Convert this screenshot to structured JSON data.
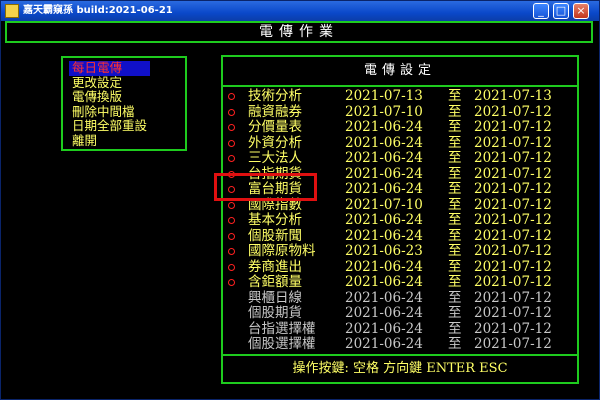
{
  "window": {
    "title": "嘉天霸窺孫 build:2021-06-21",
    "minimize_glyph": "_",
    "maximize_glyph": "□",
    "close_glyph": "×"
  },
  "header": {
    "title": "電傳作業"
  },
  "menu": {
    "items": [
      {
        "label": "每日電傳",
        "active": true
      },
      {
        "label": "更改設定",
        "active": false
      },
      {
        "label": "電傳換版",
        "active": false
      },
      {
        "label": "刪除中間檔",
        "active": false
      },
      {
        "label": "日期全部重設",
        "active": false
      },
      {
        "label": "離開",
        "active": false
      }
    ]
  },
  "settings": {
    "title": "電傳設定",
    "separator": "至",
    "rows": [
      {
        "name": "技術分析",
        "start": "2021-07-13",
        "end": "2021-07-13",
        "enabled": true
      },
      {
        "name": "融資融券",
        "start": "2021-07-10",
        "end": "2021-07-12",
        "enabled": true
      },
      {
        "name": "分價量表",
        "start": "2021-06-24",
        "end": "2021-07-12",
        "enabled": true
      },
      {
        "name": "外資分析",
        "start": "2021-06-24",
        "end": "2021-07-12",
        "enabled": true
      },
      {
        "name": "三大法人",
        "start": "2021-06-24",
        "end": "2021-07-12",
        "enabled": true
      },
      {
        "name": "台指期貨",
        "start": "2021-06-24",
        "end": "2021-07-12",
        "enabled": true
      },
      {
        "name": "富台期貨",
        "start": "2021-06-24",
        "end": "2021-07-12",
        "enabled": true
      },
      {
        "name": "國際指數",
        "start": "2021-07-10",
        "end": "2021-07-12",
        "enabled": true
      },
      {
        "name": "基本分析",
        "start": "2021-06-24",
        "end": "2021-07-12",
        "enabled": true
      },
      {
        "name": "個股新聞",
        "start": "2021-06-24",
        "end": "2021-07-12",
        "enabled": true
      },
      {
        "name": "國際原物料",
        "start": "2021-06-23",
        "end": "2021-07-12",
        "enabled": true
      },
      {
        "name": "券商進出",
        "start": "2021-06-24",
        "end": "2021-07-12",
        "enabled": true
      },
      {
        "name": "含鉅額量",
        "start": "2021-06-24",
        "end": "2021-07-12",
        "enabled": true
      },
      {
        "name": "興櫃日線",
        "start": "2021-06-24",
        "end": "2021-07-12",
        "enabled": false
      },
      {
        "name": "個股期貨",
        "start": "2021-06-24",
        "end": "2021-07-12",
        "enabled": false
      },
      {
        "name": "台指選擇權",
        "start": "2021-06-24",
        "end": "2021-07-12",
        "enabled": false
      },
      {
        "name": "個股選擇權",
        "start": "2021-06-24",
        "end": "2021-07-12",
        "enabled": false
      }
    ]
  },
  "footer": {
    "text": "操作按鍵: 空格 方向鍵 ENTER ESC"
  },
  "colors": {
    "border_green": "#1ecb1e",
    "text_yellow": "#ffff66",
    "text_gray": "#c8c8c8",
    "marker_red": "#ff2020",
    "menu_active_bg": "#1010c8",
    "highlight_red": "#e01010"
  }
}
